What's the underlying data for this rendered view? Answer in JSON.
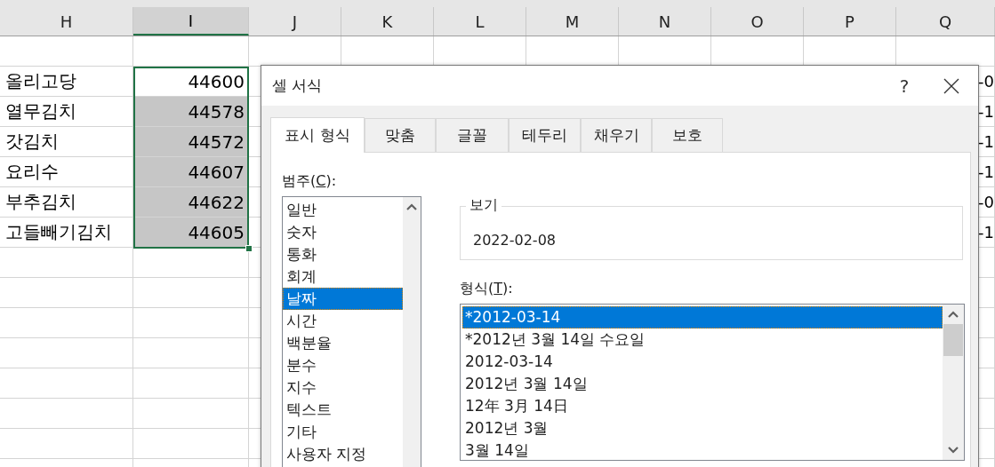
{
  "sheet": {
    "columns": [
      {
        "label": "H",
        "selected": false
      },
      {
        "label": "I",
        "selected": true
      },
      {
        "label": "J",
        "selected": false
      },
      {
        "label": "K",
        "selected": false
      },
      {
        "label": "L",
        "selected": false
      },
      {
        "label": "M",
        "selected": false
      },
      {
        "label": "N",
        "selected": false
      },
      {
        "label": "O",
        "selected": false
      },
      {
        "label": "P",
        "selected": false
      },
      {
        "label": "Q",
        "selected": false
      }
    ],
    "rows": [
      {
        "name": "올리고당",
        "value": "44600",
        "active": true,
        "q": "-0"
      },
      {
        "name": "열무김치",
        "value": "44578",
        "active": false,
        "q": "-1"
      },
      {
        "name": "갓김치",
        "value": "44572",
        "active": false,
        "q": "-1"
      },
      {
        "name": "요리수",
        "value": "44607",
        "active": false,
        "q": "-1"
      },
      {
        "name": "부추김치",
        "value": "44622",
        "active": false,
        "q": "-0"
      },
      {
        "name": "고들빼기김치",
        "value": "44605",
        "active": false,
        "q": "-1"
      }
    ]
  },
  "dialog": {
    "title": "셀 서식",
    "help": "?",
    "tabs": [
      {
        "label": "표시 형식",
        "selected": true
      },
      {
        "label": "맞춤",
        "selected": false
      },
      {
        "label": "글꼴",
        "selected": false
      },
      {
        "label": "테두리",
        "selected": false
      },
      {
        "label": "채우기",
        "selected": false
      },
      {
        "label": "보호",
        "selected": false
      }
    ],
    "category_label": {
      "before": "범주(",
      "key": "C",
      "after": "):"
    },
    "categories": [
      {
        "label": "일반",
        "selected": false
      },
      {
        "label": "숫자",
        "selected": false
      },
      {
        "label": "통화",
        "selected": false
      },
      {
        "label": "회계",
        "selected": false
      },
      {
        "label": "날짜",
        "selected": true
      },
      {
        "label": "시간",
        "selected": false
      },
      {
        "label": "백분율",
        "selected": false
      },
      {
        "label": "분수",
        "selected": false
      },
      {
        "label": "지수",
        "selected": false
      },
      {
        "label": "텍스트",
        "selected": false
      },
      {
        "label": "기타",
        "selected": false
      },
      {
        "label": "사용자 지정",
        "selected": false
      }
    ],
    "sample": {
      "label": "보기",
      "value": "2022-02-08"
    },
    "type_label": {
      "before": "형식(",
      "key": "T",
      "after": "):"
    },
    "types": [
      {
        "label": "*2012-03-14",
        "selected": true
      },
      {
        "label": "*2012년 3월 14일 수요일",
        "selected": false
      },
      {
        "label": "2012-03-14",
        "selected": false
      },
      {
        "label": "2012년 3월 14일",
        "selected": false
      },
      {
        "label": "12年 3月 14日",
        "selected": false
      },
      {
        "label": "2012년 3월",
        "selected": false
      },
      {
        "label": "3월 14일",
        "selected": false
      }
    ]
  }
}
